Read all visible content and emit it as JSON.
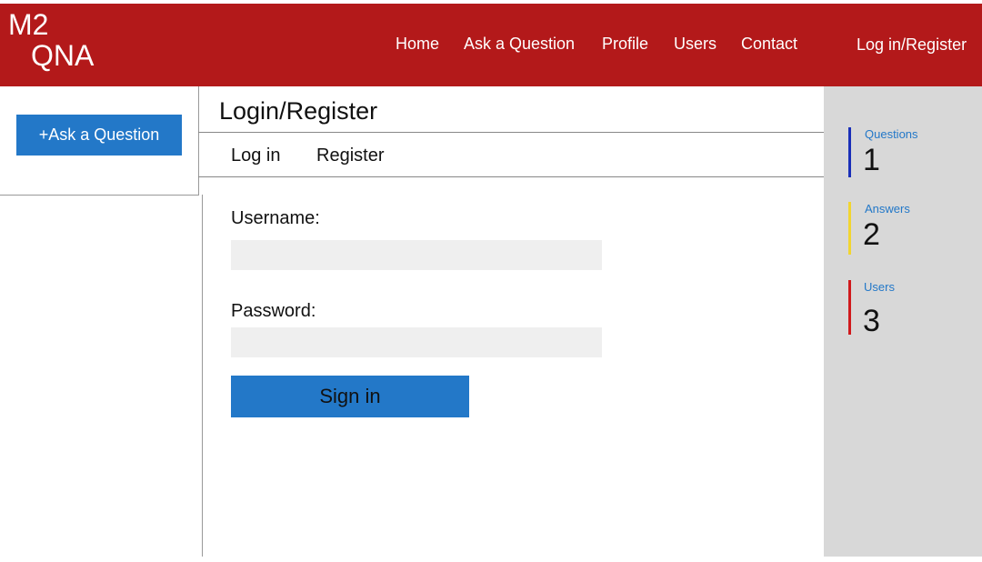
{
  "logo": {
    "line1": "M2",
    "line2": "QNA"
  },
  "nav": {
    "items": [
      "Home",
      "Ask a Question",
      "Profile",
      "Users",
      "Contact"
    ],
    "login": "Log in/Register"
  },
  "sidebar": {
    "ask_button": "+Ask a Question"
  },
  "main": {
    "title": "Login/Register",
    "tabs": [
      "Log in",
      "Register"
    ],
    "username_label": "Username:",
    "username_value": "",
    "password_label": "Password:",
    "password_value": "",
    "signin_button": "Sign in"
  },
  "stats": [
    {
      "label": "Questions",
      "value": "1",
      "color": "#1a2fb8"
    },
    {
      "label": "Answers",
      "value": "2",
      "color": "#f2d530"
    },
    {
      "label": "Users",
      "value": "3",
      "color": "#d0191c"
    }
  ],
  "colors": {
    "header": "#b3191a",
    "primary_button": "#2378c8",
    "stats_panel": "#d8d8d8",
    "input_bg": "#efefef"
  }
}
